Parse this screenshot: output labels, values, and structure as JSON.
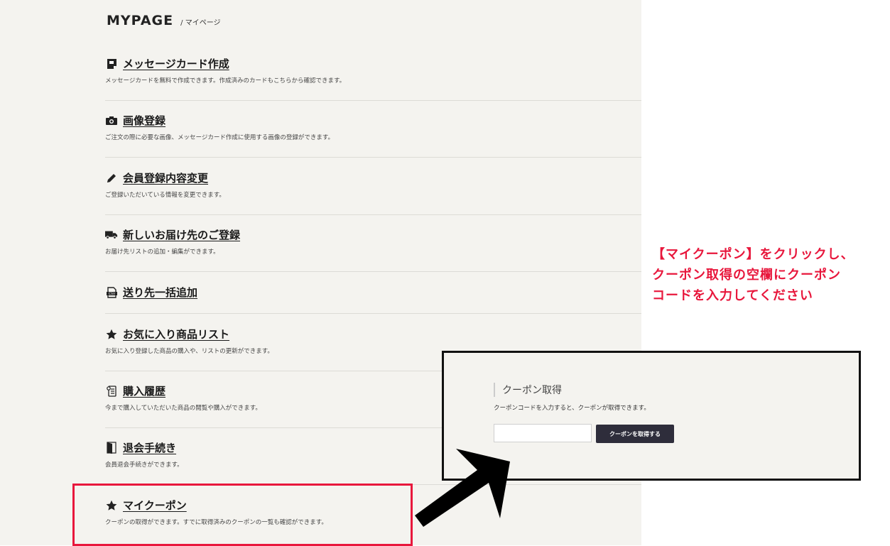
{
  "header": {
    "title": "MYPAGE",
    "subtitle": "/ マイページ"
  },
  "menu": [
    {
      "icon": "message-card-icon",
      "label": "メッセージカード作成",
      "desc": "メッセージカードを無料で作成できます。作成済みのカードもこちらから確認できます。"
    },
    {
      "icon": "camera-icon",
      "label": "画像登録",
      "desc": "ご注文の際に必要な画像、メッセージカード作成に使用する画像の登録ができます。"
    },
    {
      "icon": "pencil-icon",
      "label": "会員登録内容変更",
      "desc": "ご登録いただいている情報を変更できます。"
    },
    {
      "icon": "truck-icon",
      "label": "新しいお届け先のご登録",
      "desc": "お届け先リストの追加・編集ができます。"
    },
    {
      "icon": "csv-file-icon",
      "label": "送り先一括追加",
      "desc": ""
    },
    {
      "icon": "star-icon",
      "label": "お気に入り商品リスト",
      "desc": "お気に入り登録した商品の購入や、リストの更新ができます。"
    },
    {
      "icon": "receipt-icon",
      "label": "購入履歴",
      "desc": "今まで購入していただいた商品の閲覧や購入ができます。"
    },
    {
      "icon": "door-icon",
      "label": "退会手続き",
      "desc": "会員退会手続きができます。"
    },
    {
      "icon": "star-icon",
      "label": "マイクーポン",
      "desc": "クーポンの取得ができます。すでに取得済みのクーポンの一覧も確認ができます。"
    }
  ],
  "annotation": {
    "line1": "【マイクーポン】をクリックし、",
    "line2": "クーポン取得の空欄にクーポン",
    "line3": "コードを入力してください"
  },
  "coupon": {
    "title": "クーポン取得",
    "desc": "クーポンコードを入力すると、クーポンが取得できます。",
    "input_value": "",
    "button_label": "クーポンを取得する"
  },
  "colors": {
    "accent": "#e8173c",
    "panel": "#f4f3ef",
    "button": "#2e2d3b"
  }
}
